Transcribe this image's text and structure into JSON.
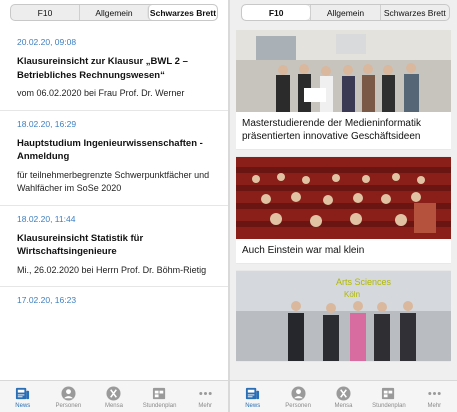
{
  "left": {
    "segments": [
      {
        "label": "F10",
        "active": false
      },
      {
        "label": "Allgemein",
        "active": false
      },
      {
        "label": "Schwarzes Brett",
        "active": true
      }
    ],
    "news": [
      {
        "date": "20.02.20, 09:08",
        "title": "Klausureinsicht zur Klausur „BWL 2 – Betriebliches Rechnungswesen“",
        "body": "vom 06.02.2020 bei Frau Prof. Dr. Werner"
      },
      {
        "date": "18.02.20, 16:29",
        "title": "Hauptstudium Ingenieurwissenschaften - Anmeldung",
        "body": "für teilnehmerbegrenzte Schwerpunktfächer und Wahlfächer im SoSe 2020"
      },
      {
        "date": "18.02.20, 11:44",
        "title": "Klausureinsicht Statistik für Wirtschaftsingenieure",
        "body": "Mi., 26.02.2020 bei Herrn Prof. Dr. Böhm-Rietig"
      },
      {
        "date": "17.02.20, 16:23",
        "title": "",
        "body": ""
      }
    ],
    "tabs": [
      {
        "label": "News",
        "icon": "news-icon",
        "active": true
      },
      {
        "label": "Personen",
        "icon": "person-icon",
        "active": false
      },
      {
        "label": "Mensa",
        "icon": "mensa-icon",
        "active": false
      },
      {
        "label": "Stundenplan",
        "icon": "timetable-icon",
        "active": false
      },
      {
        "label": "Mehr",
        "icon": "more-icon",
        "active": false
      }
    ]
  },
  "right": {
    "segments": [
      {
        "label": "F10",
        "active": true
      },
      {
        "label": "Allgemein",
        "active": false
      },
      {
        "label": "Schwarzes Brett",
        "active": false
      }
    ],
    "cards": [
      {
        "title": "Masterstudierende der Medieninformatik präsentierten innovative Geschäftsideen",
        "image": "group-photo"
      },
      {
        "title": "Auch Einstein war mal klein",
        "image": "lecture-hall-photo"
      },
      {
        "title": "",
        "image": "campus-group-photo",
        "sign_text": "Arts Sciences",
        "sign_text2": "Köln"
      }
    ],
    "tabs": [
      {
        "label": "News",
        "icon": "news-icon",
        "active": true
      },
      {
        "label": "Personen",
        "icon": "person-icon",
        "active": false
      },
      {
        "label": "Mensa",
        "icon": "mensa-icon",
        "active": false
      },
      {
        "label": "Stundenplan",
        "icon": "timetable-icon",
        "active": false
      },
      {
        "label": "Mehr",
        "icon": "more-icon",
        "active": false
      }
    ]
  },
  "colors": {
    "accent": "#2a6fb5",
    "date": "#3d7fc1",
    "tab_inactive": "#8a8a8a"
  }
}
